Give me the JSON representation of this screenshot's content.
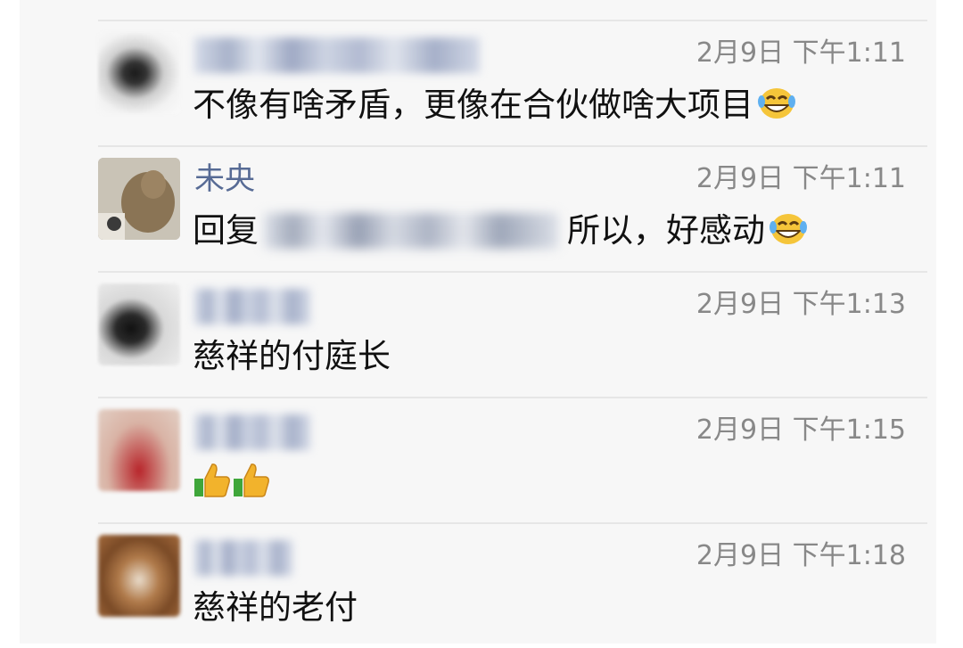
{
  "comments": [
    {
      "name": "",
      "time": "2月9日 下午1:11",
      "text": "不像有啥矛盾，更像在合伙做啥大项目",
      "emoji": "laughing-tears-emoji"
    },
    {
      "name": "未央",
      "time": "2月9日 下午1:11",
      "reply_prefix": "回复",
      "text": "所以，好感动",
      "emoji": "laughing-tears-emoji"
    },
    {
      "name": "",
      "time": "2月9日 下午1:13",
      "text": "慈祥的付庭长"
    },
    {
      "name": "",
      "time": "2月9日 下午1:15",
      "text": "",
      "emoji": "thumbs-up-emoji x2"
    },
    {
      "name": "",
      "time": "2月9日 下午1:18",
      "text": "慈祥的老付"
    }
  ],
  "colors": {
    "name": "#576b95",
    "time": "#888888",
    "text": "#111111",
    "background": "#f7f7f7"
  }
}
